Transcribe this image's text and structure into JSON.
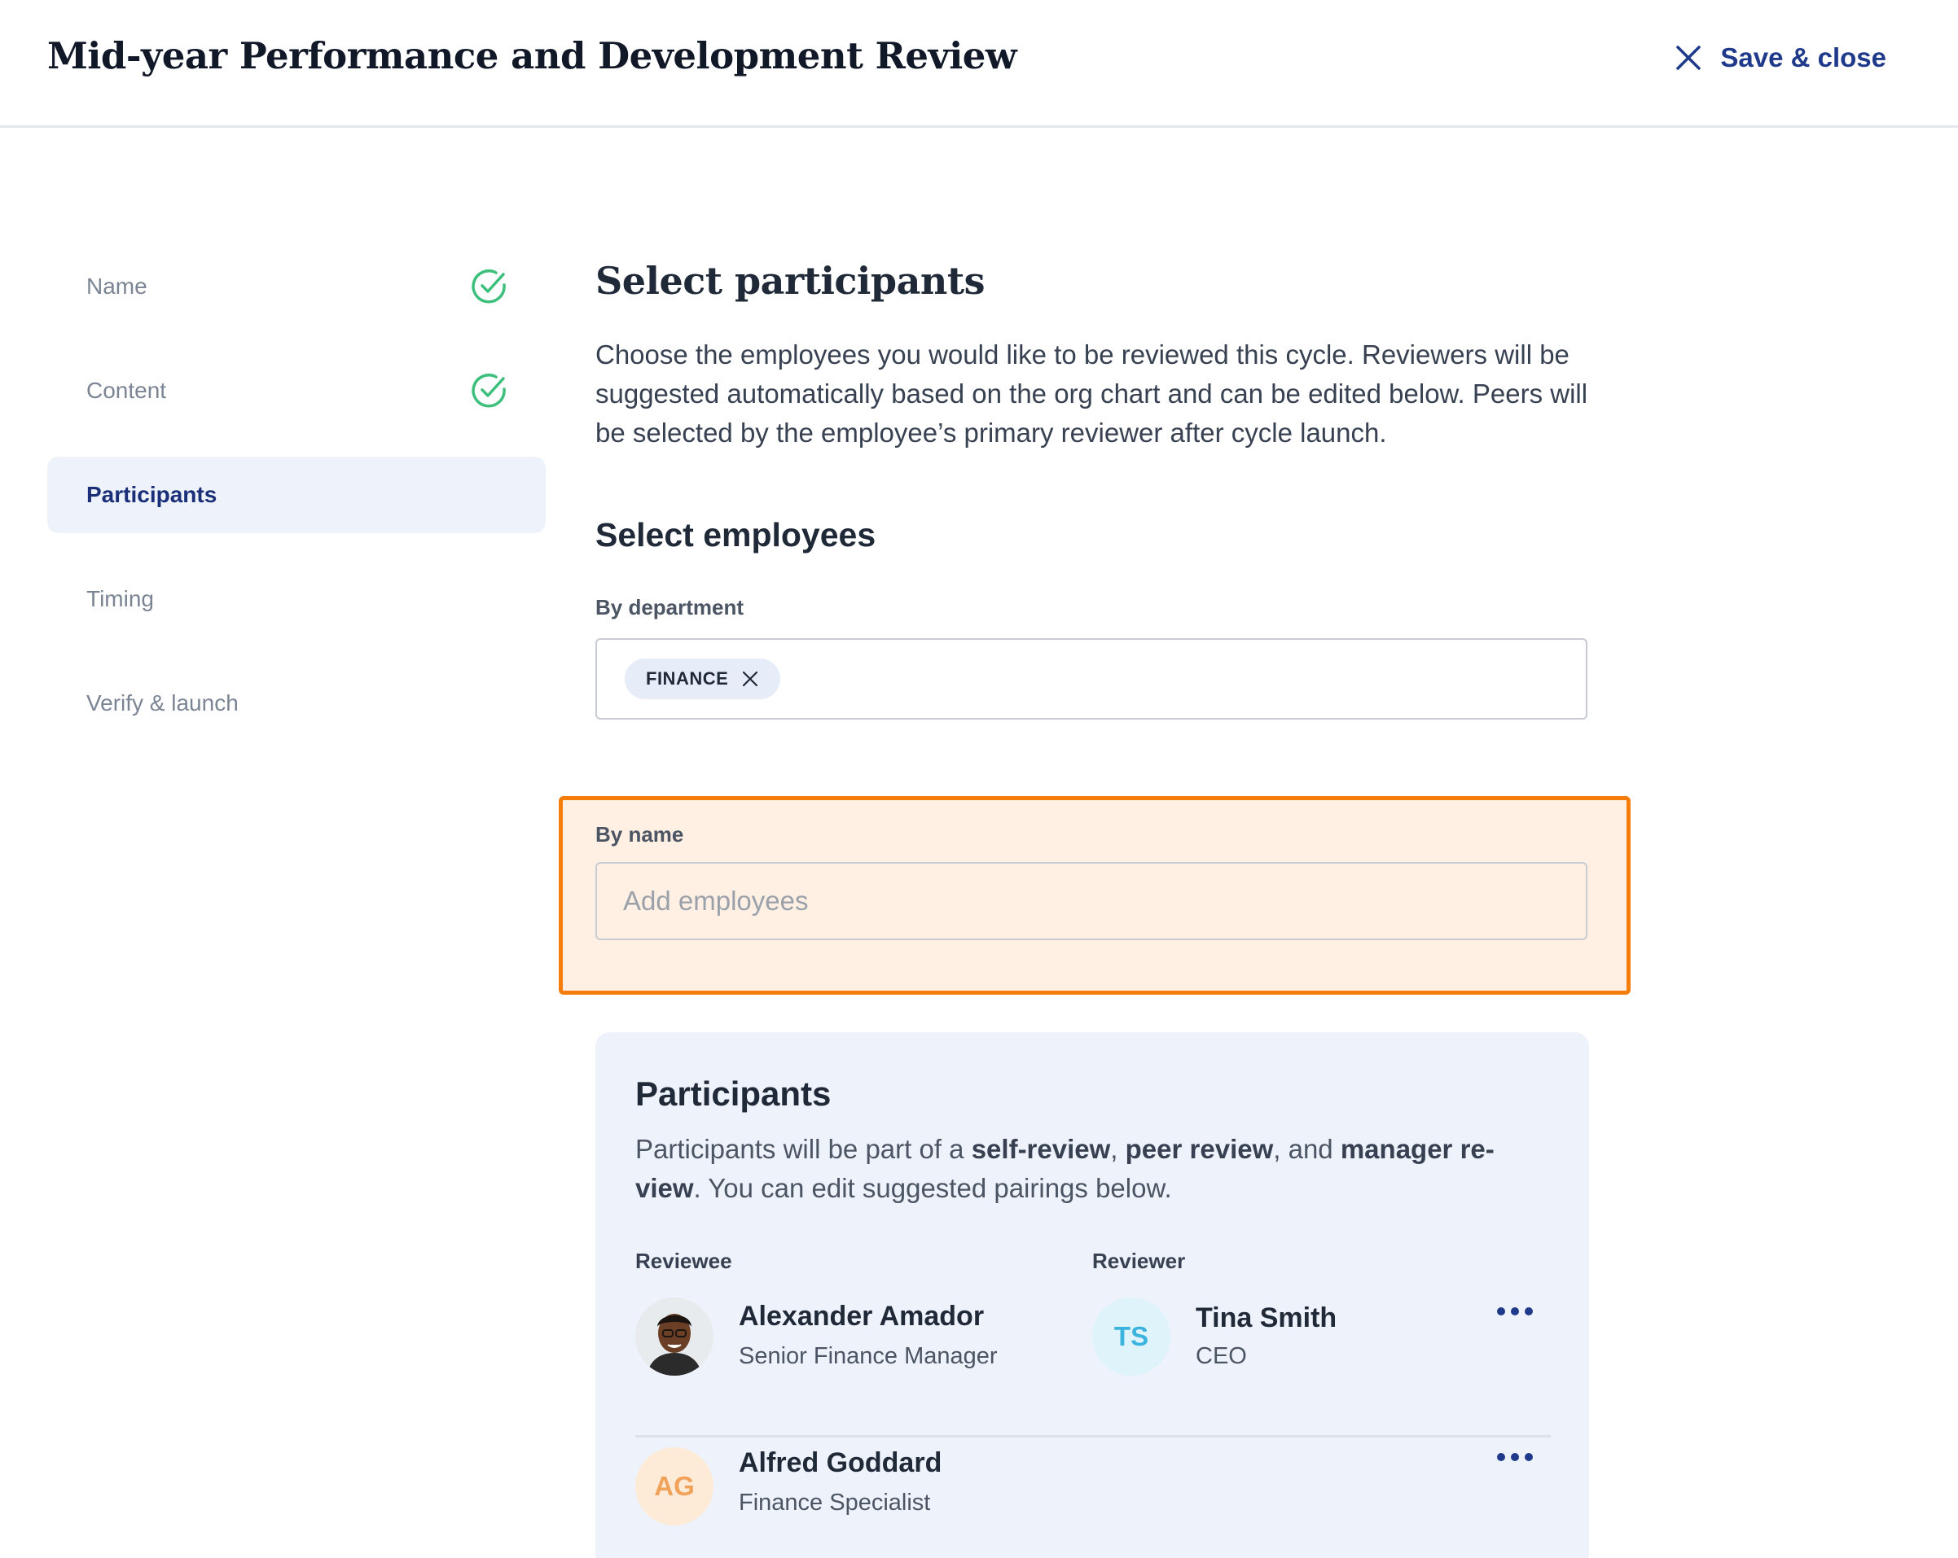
{
  "header": {
    "title": "Mid-year Performance and Development Review",
    "save_close_label": "Save & close"
  },
  "sidebar": {
    "steps": [
      {
        "label": "Name",
        "status": "complete"
      },
      {
        "label": "Content",
        "status": "complete"
      },
      {
        "label": "Participants",
        "status": "active"
      },
      {
        "label": "Timing",
        "status": "pending"
      },
      {
        "label": "Verify & launch",
        "status": "pending"
      }
    ]
  },
  "main": {
    "title": "Select participants",
    "intro": "Choose the employees you would like to be reviewed this cycle. Reviewers will be suggested automatically based on the org chart and can be edited below. Peers will be selected by the employee’s primary reviewer after cycle launch.",
    "select_employees_title": "Select employees",
    "by_department_label": "By department",
    "department_chips": [
      "FINANCE"
    ],
    "by_name_label": "By name",
    "by_name_placeholder": "Add employees"
  },
  "participants": {
    "title": "Participants",
    "desc_part1": "Participants will be part of a ",
    "desc_self": "self-review",
    "desc_sep1": ", ",
    "desc_peer": "peer review",
    "desc_sep2": ", and ",
    "desc_manager": "manager re-view",
    "desc_part2": ". You can edit suggested pairings below.",
    "col_reviewee": "Reviewee",
    "col_reviewer": "Reviewer",
    "rows": [
      {
        "reviewee_name": "Alexander Amador",
        "reviewee_role": "Senior Finance Manager",
        "reviewer_initials": "TS",
        "reviewer_name": "Tina Smith",
        "reviewer_role": "CEO"
      },
      {
        "reviewee_initials": "AG",
        "reviewee_name": "Alfred Goddard",
        "reviewee_role": "Finance Specialist"
      }
    ]
  },
  "colors": {
    "accent": "#1f3a8a",
    "success": "#3cc07b",
    "highlight_border": "#f47d0c",
    "highlight_fill": "#fff0e3",
    "panel_bg": "#eef2fb"
  }
}
